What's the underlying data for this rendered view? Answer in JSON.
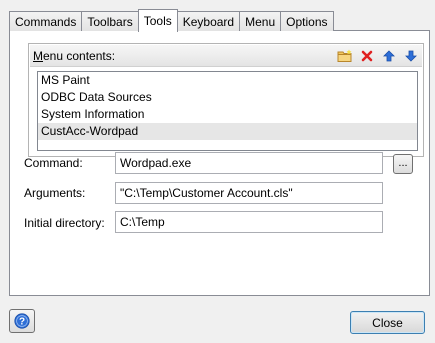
{
  "tabs": [
    {
      "label": "Commands",
      "active": false
    },
    {
      "label": "Toolbars",
      "active": false
    },
    {
      "label": "Tools",
      "active": true
    },
    {
      "label": "Keyboard",
      "active": false
    },
    {
      "label": "Menu",
      "active": false
    },
    {
      "label": "Options",
      "active": false
    }
  ],
  "menu_contents": {
    "title_accel": "M",
    "title_rest": "enu contents:",
    "toolbar": [
      {
        "name": "new-folder-icon",
        "color": "#e8b84a"
      },
      {
        "name": "delete-icon",
        "color": "#e02020"
      },
      {
        "name": "move-up-icon",
        "color": "#2e6fd8"
      },
      {
        "name": "move-down-icon",
        "color": "#2e6fd8"
      }
    ],
    "items": [
      {
        "label": "MS Paint",
        "selected": false
      },
      {
        "label": "ODBC Data Sources",
        "selected": false
      },
      {
        "label": "System Information",
        "selected": false
      },
      {
        "label": "CustAcc-Wordpad",
        "selected": true
      }
    ]
  },
  "fields": {
    "command": {
      "label": "Command:",
      "value": "Wordpad.exe"
    },
    "arguments": {
      "label": "Arguments:",
      "value": "\"C:\\Temp\\Customer Account.cls\""
    },
    "initial_directory": {
      "label": "Initial directory:",
      "value": "C:\\Temp"
    }
  },
  "browse_button_label": "...",
  "close_button_label": "Close",
  "help_icon": "help-icon"
}
